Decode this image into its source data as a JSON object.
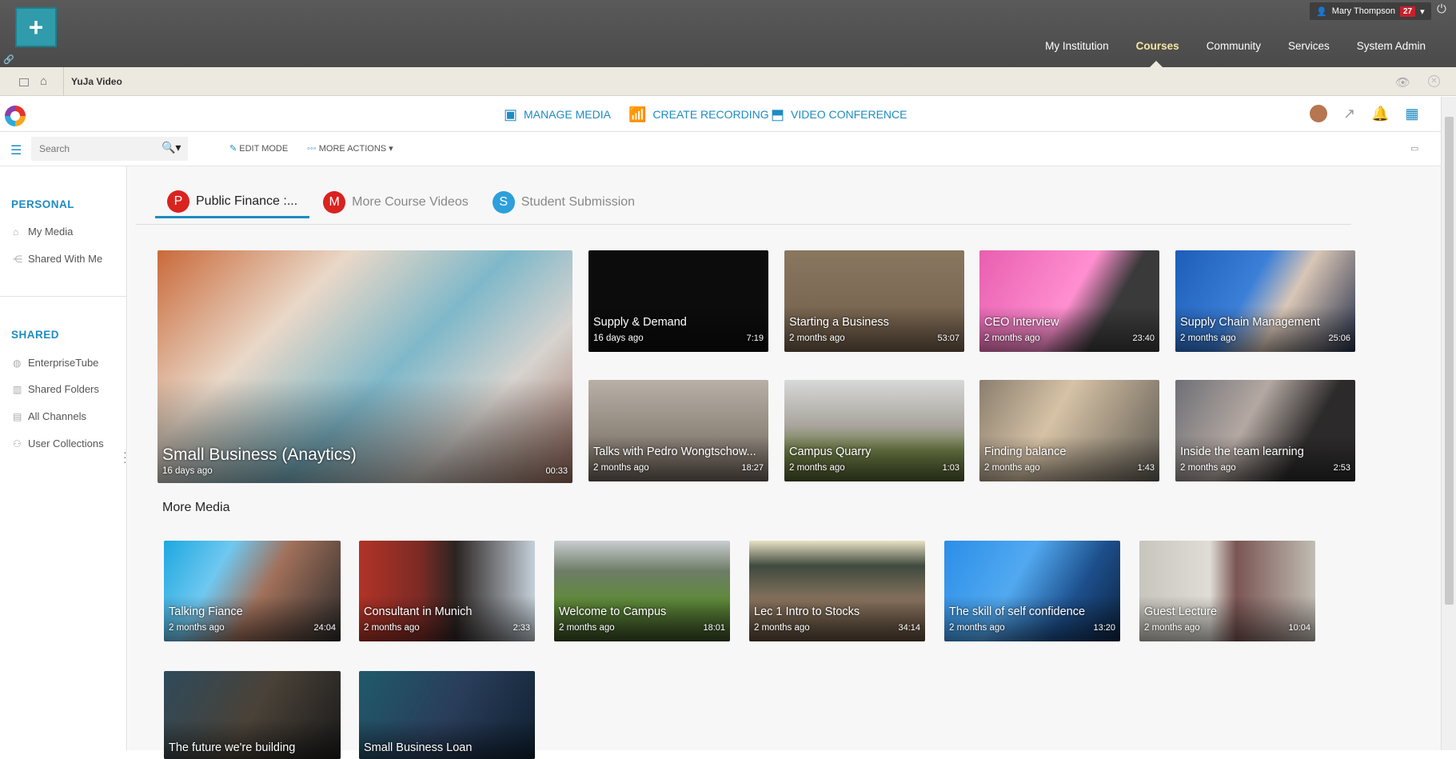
{
  "topbar": {
    "user_name": "Mary Thompson",
    "notif_count": "27",
    "nav": [
      "My Institution",
      "Courses",
      "Community",
      "Services",
      "System Admin"
    ],
    "active_nav": "Courses"
  },
  "strip": {
    "title": "YuJa Video"
  },
  "header": {
    "manage_media": "MANAGE MEDIA",
    "create_recording": "CREATE RECORDING",
    "video_conference": "VIDEO CONFERENCE"
  },
  "toolbar": {
    "search_placeholder": "Search",
    "edit_mode": "EDIT MODE",
    "more_actions": "MORE ACTIONS"
  },
  "sidebar": {
    "personal_title": "PERSONAL",
    "personal_items": [
      "My Media",
      "Shared With Me"
    ],
    "shared_title": "SHARED",
    "shared_items": [
      "EnterpriseTube",
      "Shared Folders",
      "All Channels",
      "User Collections"
    ]
  },
  "tabs": [
    {
      "letter": "P",
      "label": "Public Finance :...",
      "color": "#d9231f"
    },
    {
      "letter": "M",
      "label": "More Course Videos",
      "color": "#d9231f"
    },
    {
      "letter": "S",
      "label": "Student Submission",
      "color": "#2d9fdb"
    }
  ],
  "featured": {
    "title": "Small Business (Anaytics)",
    "age": "16 days ago",
    "duration": "00:33"
  },
  "grid": [
    {
      "title": "Supply & Demand",
      "age": "16 days ago",
      "duration": "7:19"
    },
    {
      "title": "Starting a Business",
      "age": "2 months ago",
      "duration": "53:07"
    },
    {
      "title": "CEO Interview",
      "age": "2 months ago",
      "duration": "23:40"
    },
    {
      "title": "Supply Chain Management",
      "age": "2 months ago",
      "duration": "25:06"
    },
    {
      "title": "Talks with Pedro Wongtschow...",
      "age": "2 months ago",
      "duration": "18:27"
    },
    {
      "title": "Campus Quarry",
      "age": "2 months ago",
      "duration": "1:03"
    },
    {
      "title": "Finding balance",
      "age": "2 months ago",
      "duration": "1:43"
    },
    {
      "title": "Inside the team learning",
      "age": "2 months ago",
      "duration": "2:53"
    }
  ],
  "more_media_title": "More Media",
  "more_media": [
    {
      "title": "Talking Fiance",
      "age": "2 months ago",
      "duration": "24:04"
    },
    {
      "title": "Consultant in Munich",
      "age": "2 months ago",
      "duration": "2:33"
    },
    {
      "title": "Welcome to Campus",
      "age": "2 months ago",
      "duration": "18:01"
    },
    {
      "title": "Lec 1 Intro to Stocks",
      "age": "2 months ago",
      "duration": "34:14"
    },
    {
      "title": "The skill of self confidence",
      "age": "2 months ago",
      "duration": "13:20"
    },
    {
      "title": "Guest Lecture",
      "age": "2 months ago",
      "duration": "10:04"
    },
    {
      "title": "The future we're building",
      "age": "",
      "duration": ""
    },
    {
      "title": "Small Business Loan",
      "age": "",
      "duration": ""
    }
  ]
}
